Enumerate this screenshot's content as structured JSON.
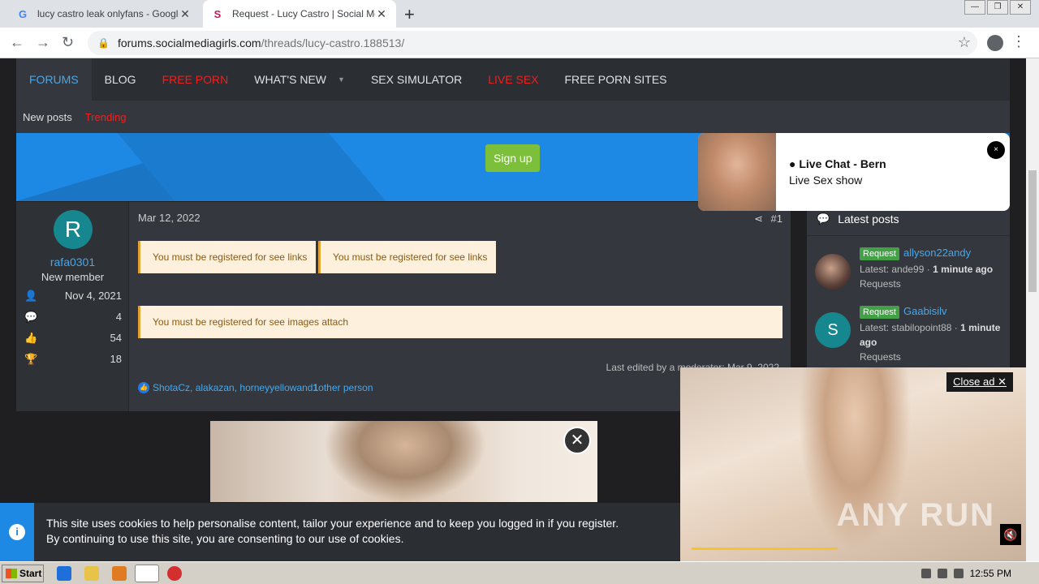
{
  "browser": {
    "tabs": [
      {
        "title": "lucy castro leak onlyfans - Google Se",
        "favicon": "G"
      },
      {
        "title": "Request - Lucy Castro | Social Media",
        "favicon": "S"
      }
    ],
    "url_host": "forums.socialmediagirls.com",
    "url_path": "/threads/lucy-castro.188513/"
  },
  "nav": {
    "items": [
      {
        "label": "FORUMS",
        "style": "active"
      },
      {
        "label": "BLOG",
        "style": "normal"
      },
      {
        "label": "FREE PORN",
        "style": "red"
      },
      {
        "label": "WHAT'S NEW",
        "style": "normal"
      },
      {
        "label": "SEX SIMULATOR",
        "style": "normal"
      },
      {
        "label": "LIVE SEX",
        "style": "red"
      },
      {
        "label": "FREE PORN SITES",
        "style": "normal"
      }
    ],
    "sub": [
      {
        "label": "New posts"
      },
      {
        "label": "Trending"
      }
    ]
  },
  "banner": {
    "signup": "Sign up"
  },
  "post": {
    "user": {
      "initial": "R",
      "name": "rafa0301",
      "title": "New member",
      "joined": "Nov 4, 2021",
      "messages": "4",
      "reactions": "54",
      "points": "18"
    },
    "date": "Mar 12, 2022",
    "number": "#1",
    "notice_link": "You must be registered for see links",
    "notice_images": "You must be registered for see images attach",
    "edited": "Last edited by a moderator: Mar 9, 2022",
    "likes_users": "ShotaCz, alakazan, horneyyellow",
    "likes_and": " and ",
    "likes_other": "1",
    "likes_other_suffix": " other person"
  },
  "sidebar": {
    "title": "Latest posts",
    "posts": [
      {
        "badge": "Request",
        "user": "allyson22andy",
        "latest_label": "Latest: ande99 · ",
        "time": "1 minute ago",
        "forum": "Requests",
        "avatar_initial": "",
        "avatar_color": "#5a4038"
      },
      {
        "badge": "Request",
        "user": "Gaabisilv",
        "latest_label": "Latest: stabilopoint88 · ",
        "time": "1 minute ago",
        "forum": "Requests",
        "avatar_initial": "S",
        "avatar_color": "#16878f"
      }
    ]
  },
  "livechat": {
    "title": "Live Chat - Bern",
    "subtitle": "Live Sex show",
    "close": "×"
  },
  "video_ad": {
    "close_label": "Close ad",
    "watermark": "ANY RUN"
  },
  "cookie": {
    "line1": "This site uses cookies to help personalise content, tailor your experience and to keep you logged in if you register.",
    "line2": "By continuing to use this site, you are consenting to our use of cookies."
  },
  "taskbar": {
    "start": "Start",
    "clock": "12:55 PM"
  }
}
